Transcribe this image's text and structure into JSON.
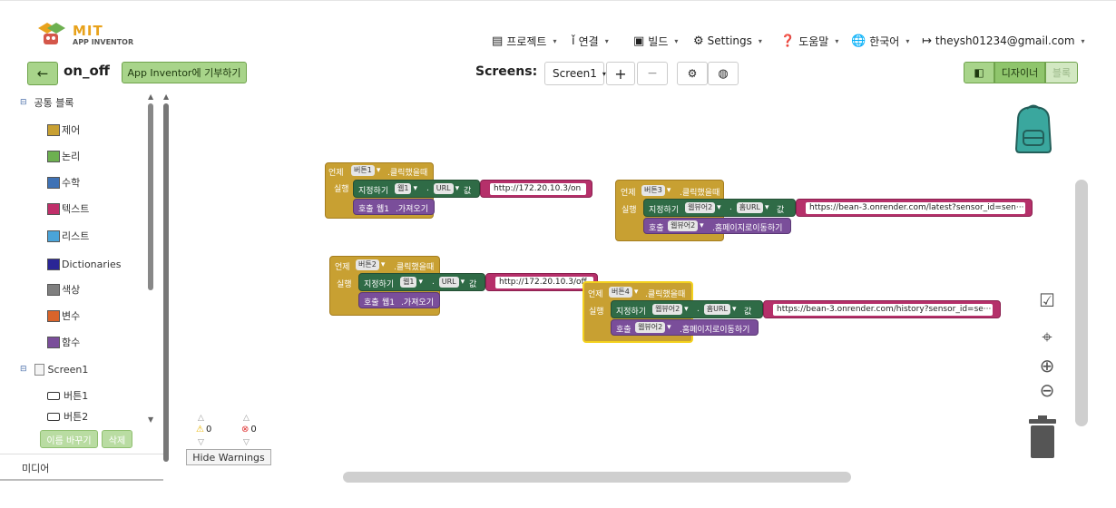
{
  "header": {
    "logo_title": "MIT",
    "logo_subtitle": "APP INVENTOR",
    "menu": [
      {
        "label": "프로젝트",
        "icon": "briefcase-icon"
      },
      {
        "label": "연결",
        "icon": "connect-icon"
      },
      {
        "label": "빌드",
        "icon": "build-icon"
      },
      {
        "label": "Settings",
        "icon": "gear-icon"
      },
      {
        "label": "도움말",
        "icon": "help-icon"
      },
      {
        "label": "한국어",
        "icon": "globe-icon"
      },
      {
        "label": "theysh01234@gmail.com",
        "icon": "logout-icon"
      }
    ]
  },
  "toolbar": {
    "project_name": "on_off",
    "donate_label": "App Inventor에 기부하기",
    "screens_label": "Screens:",
    "screen_select": "Screen1",
    "add_label": "+",
    "remove_label": "−",
    "designer_label": "디자이너",
    "blocks_label": "블록"
  },
  "palette": {
    "header": "공통 블록",
    "items": [
      {
        "label": "제어",
        "color": "#c8a032"
      },
      {
        "label": "논리",
        "color": "#6db050"
      },
      {
        "label": "수학",
        "color": "#3f72b5"
      },
      {
        "label": "텍스트",
        "color": "#c02f6a"
      },
      {
        "label": "리스트",
        "color": "#4aa4d9"
      },
      {
        "label": "Dictionaries",
        "color": "#2a2596"
      },
      {
        "label": "색상",
        "color": "#7f7f7f"
      },
      {
        "label": "변수",
        "color": "#d9642a"
      },
      {
        "label": "함수",
        "color": "#7a4e9a"
      }
    ],
    "screen": "Screen1",
    "components": [
      "버튼1",
      "버튼2"
    ],
    "rename_label": "이름 바꾸기",
    "delete_label": "삭제",
    "media_label": "미디어"
  },
  "warnings": {
    "warn_count": "0",
    "error_count": "0",
    "hide_label": "Hide Warnings"
  },
  "blocks": [
    {
      "when": "언제",
      "component": "버튼1",
      "event": ".클릭했을때",
      "do": "실행",
      "set": "지정하기",
      "target": "웹1",
      "prop": "URL",
      "to": "값",
      "value": "http://172.20.10.3/on",
      "call": "호출",
      "call_target": "웹1",
      "method": ".가져오기"
    },
    {
      "when": "언제",
      "component": "버튼2",
      "event": ".클릭했을때",
      "do": "실행",
      "set": "지정하기",
      "target": "웹1",
      "prop": "URL",
      "to": "값",
      "value": "http://172.20.10.3/off",
      "call": "호출",
      "call_target": "웹1",
      "method": ".가져오기"
    },
    {
      "when": "언제",
      "component": "버튼3",
      "event": ".클릭했을때",
      "do": "실행",
      "set": "지정하기",
      "target": "웹뷰어2",
      "prop": "홈URL",
      "to": "값",
      "value": "https://bean-3.onrender.com/latest?sensor_id=sen···",
      "call": "호출",
      "call_target": "웹뷰어2",
      "method": ".홈페이지로이동하기"
    },
    {
      "when": "언제",
      "component": "버튼4",
      "event": ".클릭했을때",
      "do": "실행",
      "set": "지정하기",
      "target": "웹뷰어2",
      "prop": "홈URL",
      "to": "값",
      "value": "https://bean-3.onrender.com/history?sensor_id=se···",
      "call": "호출",
      "call_target": "웹뷰어2",
      "method": ".홈페이지로이동하기"
    }
  ]
}
